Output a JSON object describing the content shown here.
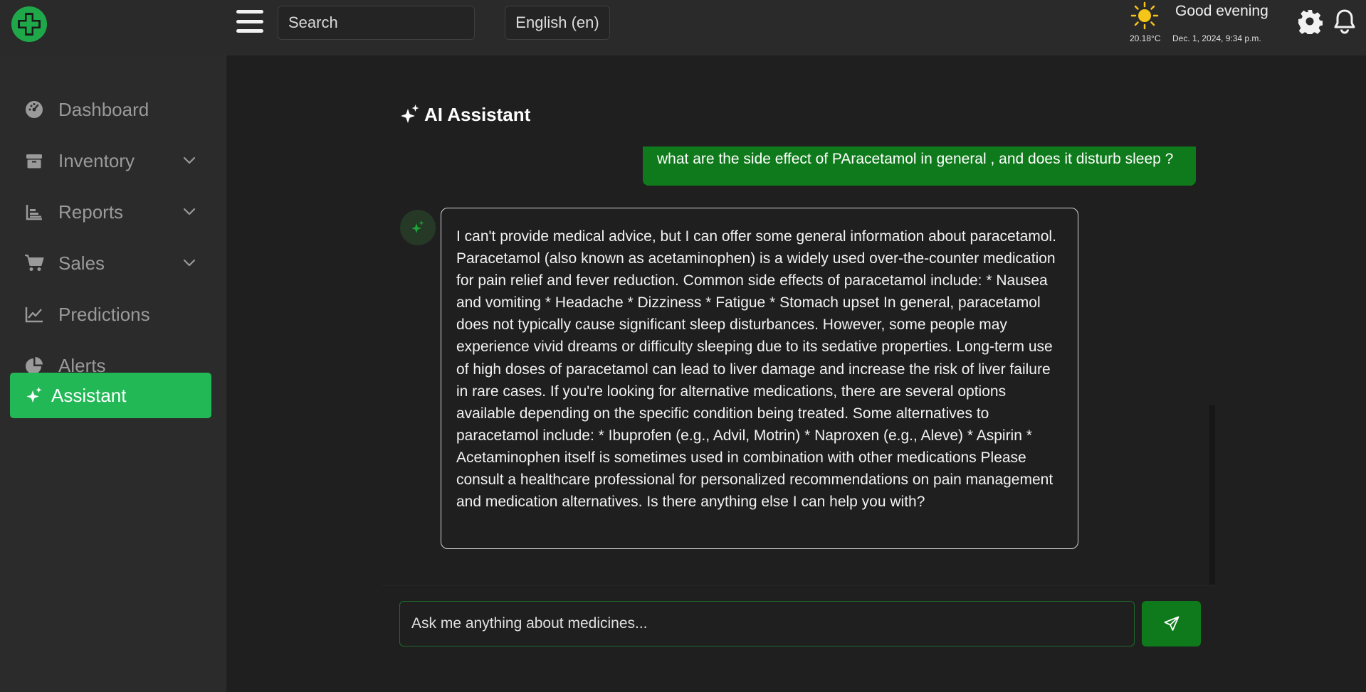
{
  "header": {
    "search_placeholder": "Search",
    "language": "English (en)",
    "temperature": "20.18°C",
    "greeting": "Good evening",
    "datetime": "Dec. 1, 2024, 9:34 p.m."
  },
  "sidebar": {
    "items": [
      {
        "label": "Dashboard",
        "icon": "gauge-icon"
      },
      {
        "label": "Inventory",
        "icon": "box-icon",
        "has_dropdown": true
      },
      {
        "label": "Reports",
        "icon": "bar-chart-icon",
        "has_dropdown": true
      },
      {
        "label": "Sales",
        "icon": "cart-icon",
        "has_dropdown": true
      },
      {
        "label": "Predictions",
        "icon": "line-chart-icon"
      },
      {
        "label": "Alerts",
        "icon": "pie-chart-icon"
      },
      {
        "label": "Assistant",
        "icon": "sparkles-icon",
        "active": true
      }
    ]
  },
  "assistant": {
    "title": "AI Assistant",
    "user_message": "what are the side effect of PAracetamol in general , and does it disturb sleep ?",
    "bot_message": "I can't provide medical advice, but I can offer some general information about paracetamol. Paracetamol (also known as acetaminophen) is a widely used over-the-counter medication for pain relief and fever reduction. Common side effects of paracetamol include: * Nausea and vomiting * Headache * Dizziness * Fatigue * Stomach upset In general, paracetamol does not typically cause significant sleep disturbances. However, some people may experience vivid dreams or difficulty sleeping due to its sedative properties. Long-term use of high doses of paracetamol can lead to liver damage and increase the risk of liver failure in rare cases. If you're looking for alternative medications, there are several options available depending on the specific condition being treated. Some alternatives to paracetamol include: * Ibuprofen (e.g., Advil, Motrin) * Naproxen (e.g., Aleve) * Aspirin * Acetaminophen itself is sometimes used in combination with other medications Please consult a healthcare professional for personalized recommendations on pain management and medication alternatives. Is there anything else I can help you with?",
    "input_placeholder": "Ask me anything about medicines..."
  },
  "colors": {
    "accent": "#22b856",
    "message_green": "#0f7a1b",
    "background": "#1f1f1f",
    "sidebar": "#2b2b2b"
  }
}
